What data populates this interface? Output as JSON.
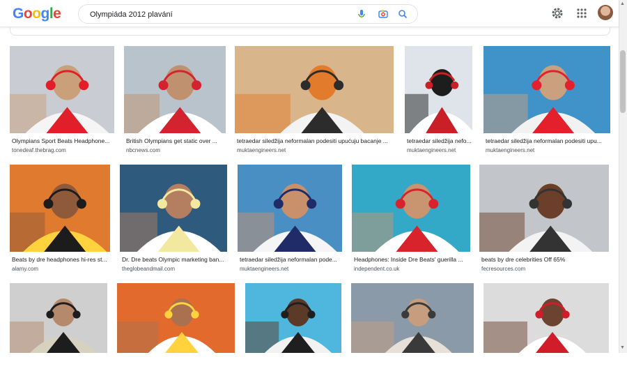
{
  "brand": {
    "logo_letters": [
      "G",
      "o",
      "o",
      "g",
      "l",
      "e"
    ],
    "logo_colors": [
      "#4285F4",
      "#EA4335",
      "#FBBC05",
      "#4285F4",
      "#34A853",
      "#EA4335"
    ]
  },
  "search": {
    "value": "Olympiáda 2012 plavání"
  },
  "icons": {
    "voice": "microphone-icon",
    "lens": "camera-icon",
    "search": "search-icon",
    "settings": "gear-icon",
    "apps": "apps-grid-icon"
  },
  "results": [
    {
      "caption": "Olympians Sport Beats Headphone...",
      "source": "tonedeaf.thebrag.com"
    },
    {
      "caption": "British Olympians get static over ...",
      "source": "nbcnews.com"
    },
    {
      "caption": "tetraedar siledžija neformalan podesiti upućuju bacanje ...",
      "source": "muktaengineers.net"
    },
    {
      "caption": "tetraedar siledžija nefo...",
      "source": "muktaengineers.net"
    },
    {
      "caption": "tetraedar siledžija neformalan podesiti upu...",
      "source": "muktaengineers.net"
    },
    {
      "caption": "Beats by dre headphones hi-res st...",
      "source": "alamy.com"
    },
    {
      "caption": "Dr. Dre beats Olympic marketing ban...",
      "source": "theglobeandmail.com"
    },
    {
      "caption": "tetraedar siledžija neformalan pode...",
      "source": "muktaengineers.net"
    },
    {
      "caption": "Headphones: Inside Dre Beats' guerilla ...",
      "source": "independent.co.uk"
    },
    {
      "caption": "beats by dre celebrities Off 65%",
      "source": "fecresources.com"
    },
    {
      "caption": "",
      "source": ""
    },
    {
      "caption": "",
      "source": ""
    },
    {
      "caption": "",
      "source": ""
    },
    {
      "caption": "",
      "source": ""
    },
    {
      "caption": "",
      "source": ""
    }
  ]
}
